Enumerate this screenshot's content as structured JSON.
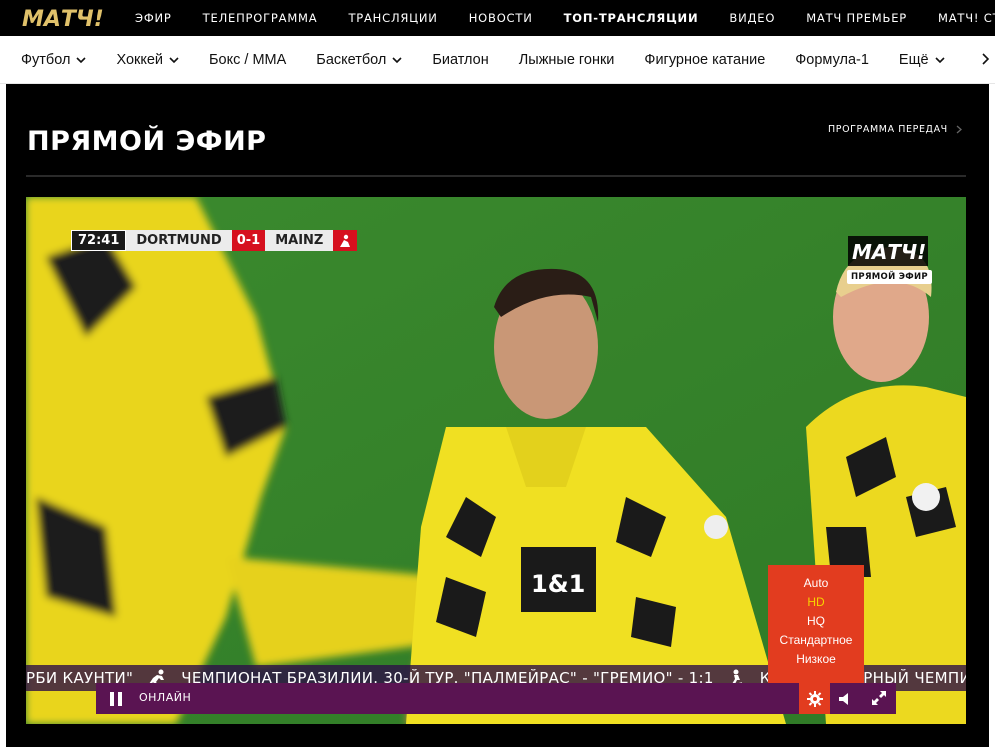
{
  "brand": {
    "logo_text": "МАТЧ!",
    "accent": "#e23c1f",
    "gold": "#e0c16a",
    "purple": "#5a1452"
  },
  "top_nav": [
    {
      "label": "ЭФИР",
      "bold": false
    },
    {
      "label": "ТЕЛЕПРОГРАММА",
      "bold": false
    },
    {
      "label": "ТРАНСЛЯЦИИ",
      "bold": false
    },
    {
      "label": "НОВОСТИ",
      "bold": false
    },
    {
      "label": "ТОП-ТРАНСЛЯЦИИ",
      "bold": true
    },
    {
      "label": "ВИДЕО",
      "bold": false
    },
    {
      "label": "МАТЧ ПРЕМЬЕР",
      "bold": false
    },
    {
      "label": "МАТЧ! СТРАНА",
      "bold": false
    }
  ],
  "sport_nav": [
    {
      "label": "Футбол",
      "dropdown": true
    },
    {
      "label": "Хоккей",
      "dropdown": true
    },
    {
      "label": "Бокс / ММА",
      "dropdown": false
    },
    {
      "label": "Баскетбол",
      "dropdown": true
    },
    {
      "label": "Биатлон",
      "dropdown": false
    },
    {
      "label": "Лыжные гонки",
      "dropdown": false
    },
    {
      "label": "Фигурное катание",
      "dropdown": false
    },
    {
      "label": "Формула-1",
      "dropdown": false
    },
    {
      "label": "Ещё",
      "dropdown": true
    }
  ],
  "page": {
    "title": "ПРЯМОЙ ЭФИР",
    "schedule_link": "ПРОГРАММА ПЕРЕДАЧ"
  },
  "player": {
    "scorebug": {
      "time": "72:41",
      "home": "DORTMUND",
      "score": "0-1",
      "away": "MAINZ"
    },
    "channel_logo": "МАТЧ!",
    "live_chip": "ПРЯМОЙ ЭФИР",
    "ticker": {
      "part1": "РБИ КАУНТИ\"",
      "part2": "ЧЕМПИОНАТ БРАЗИЛИИ. 30-Й ТУР. \"ПАЛМЕЙРАС\" - \"ГРЕМИО\" - 1:1",
      "part3": "КХЛ. РЕГУЛЯРНЫЙ ЧЕМПИОНАТ"
    },
    "status": "ОНЛАЙН",
    "quality_options": [
      "Auto",
      "HD",
      "HQ",
      "Стандартное",
      "Низкое"
    ],
    "quality_selected": "HD"
  }
}
